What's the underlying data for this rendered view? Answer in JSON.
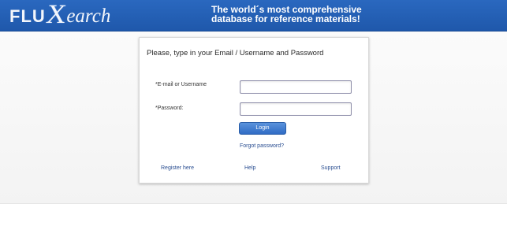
{
  "header": {
    "logo": {
      "part1": "FLU",
      "part2": "X",
      "part3": "earch"
    },
    "tagline": {
      "line1": "The world´s most comprehensive",
      "line2": "database for reference materials!"
    }
  },
  "login": {
    "instructions": "Please, type in your Email / Username and Password",
    "email_label": "*E-mail or Username",
    "email_value": "",
    "password_label": "*Password:",
    "password_value": "",
    "login_button": "Login",
    "forgot_password": "Forgot password?",
    "register_link": "Register here",
    "help_link": "Help",
    "support_link": "Support"
  },
  "colors": {
    "header_blue": "#2a68bf",
    "button_blue": "#3d7ad0",
    "link_blue": "#2a4e91"
  }
}
